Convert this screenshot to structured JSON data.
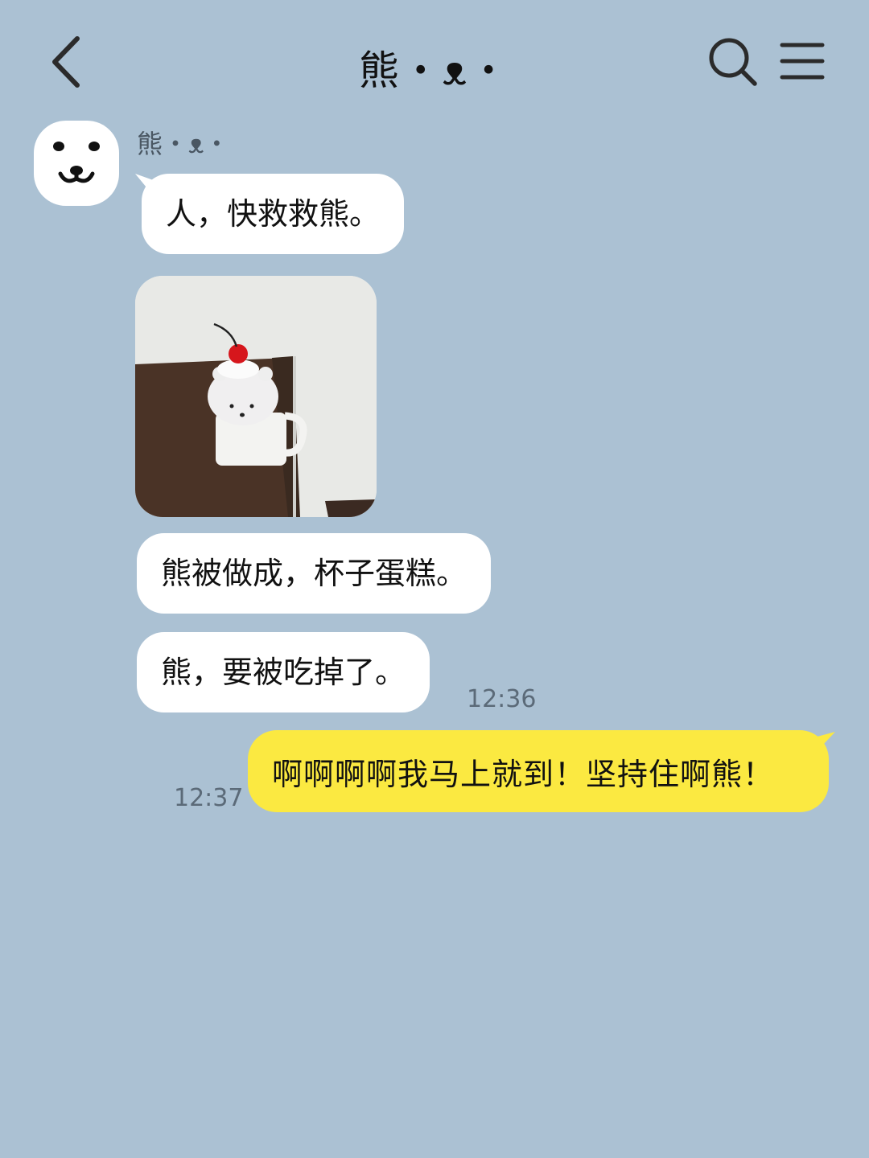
{
  "header": {
    "title": "熊・ᴥ・",
    "back_icon": "chevron-left-icon",
    "search_icon": "search-icon",
    "menu_icon": "hamburger-menu-icon"
  },
  "colors": {
    "background": "#abc1d3",
    "incoming_bubble": "#ffffff",
    "outgoing_bubble": "#fbe941"
  },
  "conversation": {
    "sender_name": "熊・ᴥ・",
    "avatar": "bear-face-icon",
    "messages": [
      {
        "type": "text",
        "from": "contact",
        "text": "人，快救救熊。"
      },
      {
        "type": "image",
        "from": "contact",
        "image": "bear-plush-cup-cake-photo"
      },
      {
        "type": "text",
        "from": "contact",
        "text": "熊被做成，杯子蛋糕。"
      },
      {
        "type": "text",
        "from": "contact",
        "text": "熊，要被吃掉了。",
        "time": "12:36"
      },
      {
        "type": "text",
        "from": "me",
        "text": "啊啊啊啊我马上就到！坚持住啊熊！",
        "time": "12:37"
      }
    ]
  }
}
